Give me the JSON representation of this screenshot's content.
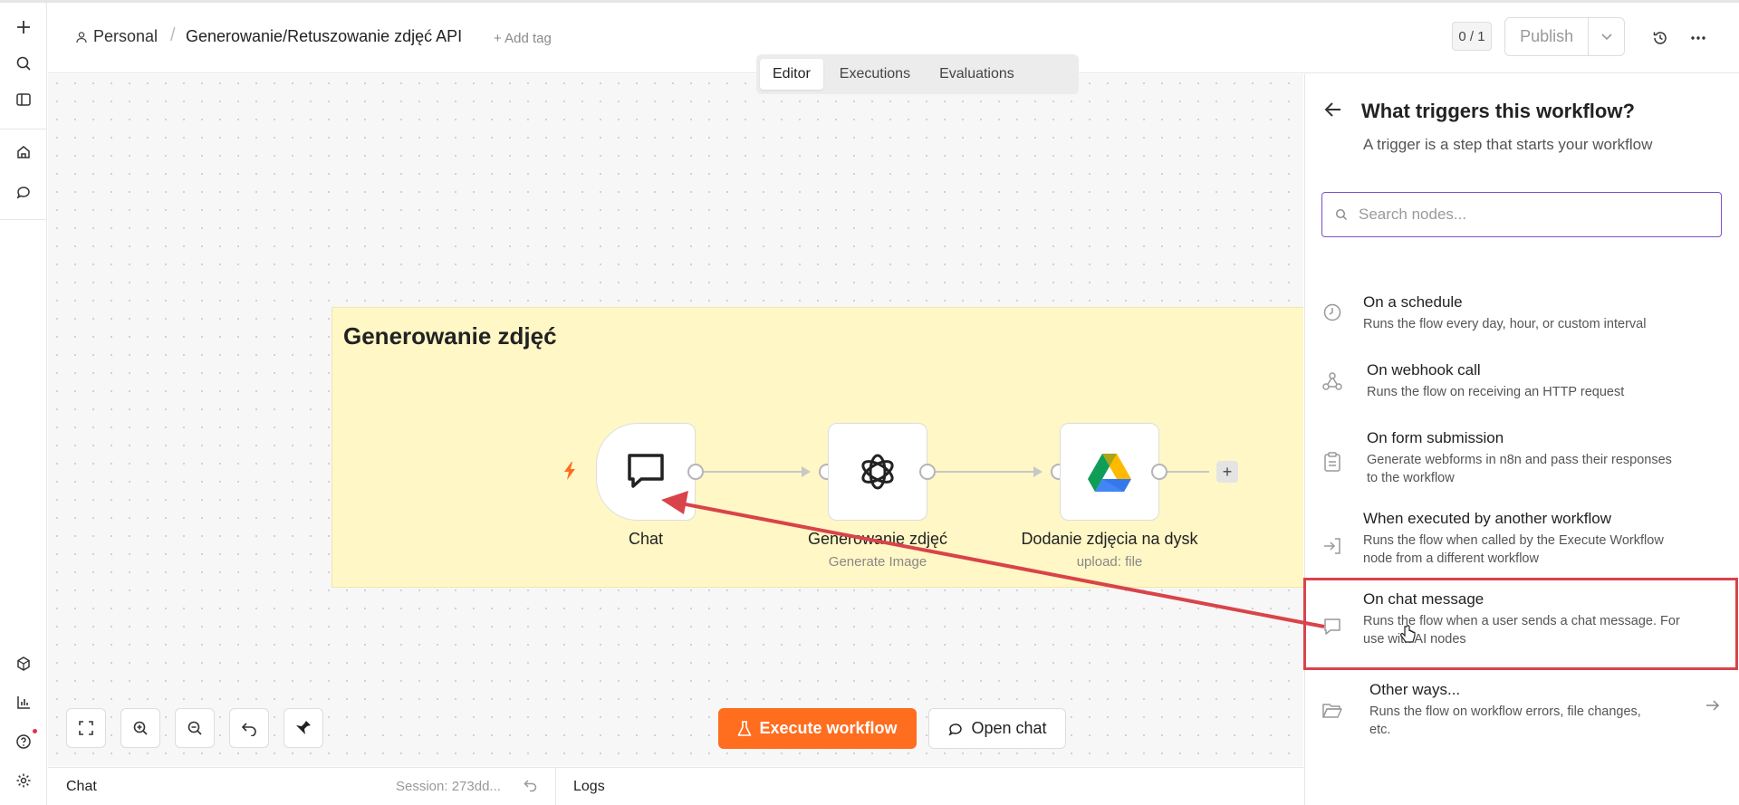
{
  "header": {
    "personal": "Personal",
    "workflow_name": "Generowanie/Retuszowanie zdjęć API",
    "add_tag": "+ Add tag",
    "counter": "0 / 1",
    "publish": "Publish"
  },
  "tabs": [
    "Editor",
    "Executions",
    "Evaluations"
  ],
  "canvas": {
    "sticky_title": "Generowanie zdjęć",
    "nodes": [
      {
        "label": "Chat",
        "sub": ""
      },
      {
        "label": "Generowanie zdjęć",
        "sub": "Generate Image"
      },
      {
        "label": "Dodanie zdjęcia na dysk",
        "sub": "upload: file"
      }
    ],
    "execute_label": "Execute workflow",
    "open_chat_label": "Open chat"
  },
  "bottom": {
    "chat": "Chat",
    "session": "Session: 273dd...",
    "logs": "Logs"
  },
  "panel": {
    "title": "What triggers this workflow?",
    "subtitle": "A trigger is a step that starts your workflow",
    "search_placeholder": "Search nodes...",
    "items": [
      {
        "title": "On a schedule",
        "desc": "Runs the flow every day, hour, or custom interval"
      },
      {
        "title": "On webhook call",
        "desc": "Runs the flow on receiving an HTTP request"
      },
      {
        "title": "On form submission",
        "desc1": "Generate webforms in n8n and pass their responses",
        "desc2": "to the workflow"
      },
      {
        "title": "When executed by another workflow",
        "desc1": "Runs the flow when called by the Execute Workflow",
        "desc2": "node from a different workflow"
      },
      {
        "title": "On chat message",
        "desc1": "Runs the flow when a user sends a chat message. For",
        "desc2": "use with AI nodes"
      },
      {
        "title": "Other ways...",
        "desc1": "Runs the flow on workflow errors, file changes,",
        "desc2": "etc."
      }
    ]
  },
  "colors": {
    "accent": "#ff6d1f",
    "focus": "#7b52c9",
    "annotation": "#d9434a",
    "sticky": "#fff7c6"
  }
}
